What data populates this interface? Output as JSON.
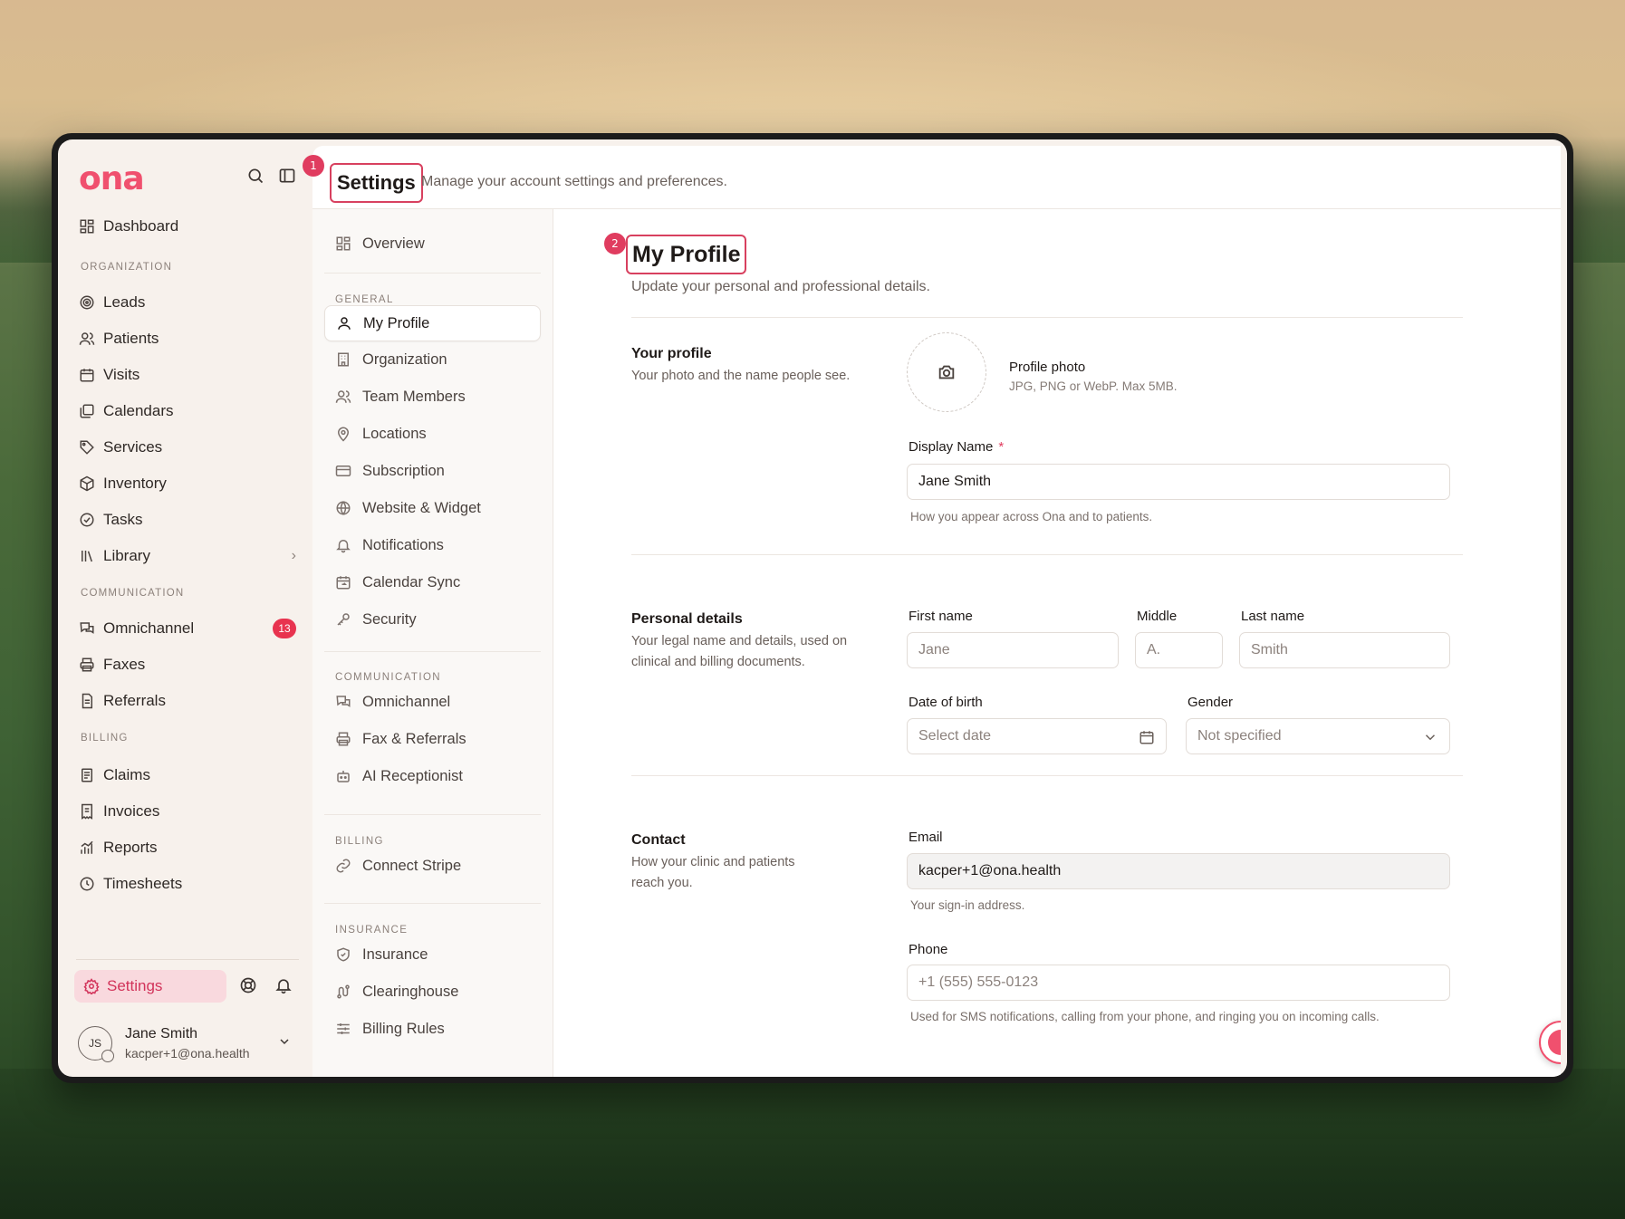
{
  "app": {
    "logo": "ona"
  },
  "sidebar": {
    "dashboard": "Dashboard",
    "sections": {
      "organization": "ORGANIZATION",
      "communication": "COMMUNICATION",
      "billing": "BILLING"
    },
    "org_items": [
      "Leads",
      "Patients",
      "Visits",
      "Calendars",
      "Services",
      "Inventory",
      "Tasks",
      "Library"
    ],
    "comm_items": [
      "Omnichannel",
      "Faxes",
      "Referrals"
    ],
    "omnichannel_badge": "13",
    "billing_items": [
      "Claims",
      "Invoices",
      "Reports",
      "Timesheets"
    ],
    "settings": "Settings",
    "user": {
      "initials": "JS",
      "name": "Jane Smith",
      "email": "kacper+1@ona.health"
    }
  },
  "header": {
    "marker": "1",
    "title": "Settings",
    "subtitle": "Manage your account settings and preferences."
  },
  "settings_nav": {
    "overview": "Overview",
    "general_label": "GENERAL",
    "general": [
      "My Profile",
      "Organization",
      "Team Members",
      "Locations",
      "Subscription",
      "Website & Widget",
      "Notifications",
      "Calendar Sync",
      "Security"
    ],
    "communication_label": "COMMUNICATION",
    "communication": [
      "Omnichannel",
      "Fax & Referrals",
      "AI Receptionist"
    ],
    "billing_label": "BILLING",
    "billing": [
      "Connect Stripe"
    ],
    "insurance_label": "INSURANCE",
    "insurance": [
      "Insurance",
      "Clearinghouse",
      "Billing Rules"
    ]
  },
  "profile": {
    "marker": "2",
    "title": "My Profile",
    "subtitle": "Update your personal and professional details.",
    "your_profile": {
      "title": "Your profile",
      "desc": "Your photo and the name people see.",
      "photo_title": "Profile photo",
      "photo_hint": "JPG, PNG or WebP. Max 5MB.",
      "display_name_label": "Display Name",
      "required_mark": "*",
      "display_name_value": "Jane Smith",
      "display_name_hint": "How you appear across Ona and to patients."
    },
    "personal": {
      "title": "Personal details",
      "desc": "Your legal name and details, used on clinical and billing documents.",
      "first_label": "First name",
      "first_placeholder": "Jane",
      "middle_label": "Middle",
      "middle_placeholder": "A.",
      "last_label": "Last name",
      "last_placeholder": "Smith",
      "dob_label": "Date of birth",
      "dob_placeholder": "Select date",
      "gender_label": "Gender",
      "gender_value": "Not specified"
    },
    "contact": {
      "title": "Contact",
      "desc": "How your clinic and patients reach you.",
      "email_label": "Email",
      "email_value": "kacper+1@ona.health",
      "email_hint": "Your sign-in address.",
      "phone_label": "Phone",
      "phone_placeholder": "+1 (555) 555-0123",
      "phone_hint": "Used for SMS notifications, calling from your phone, and ringing you on incoming calls."
    }
  },
  "colors": {
    "accent": "#f0506e",
    "highlight": "#d8405f",
    "badge": "#e8334f",
    "app_bg": "#f7f1ec"
  }
}
